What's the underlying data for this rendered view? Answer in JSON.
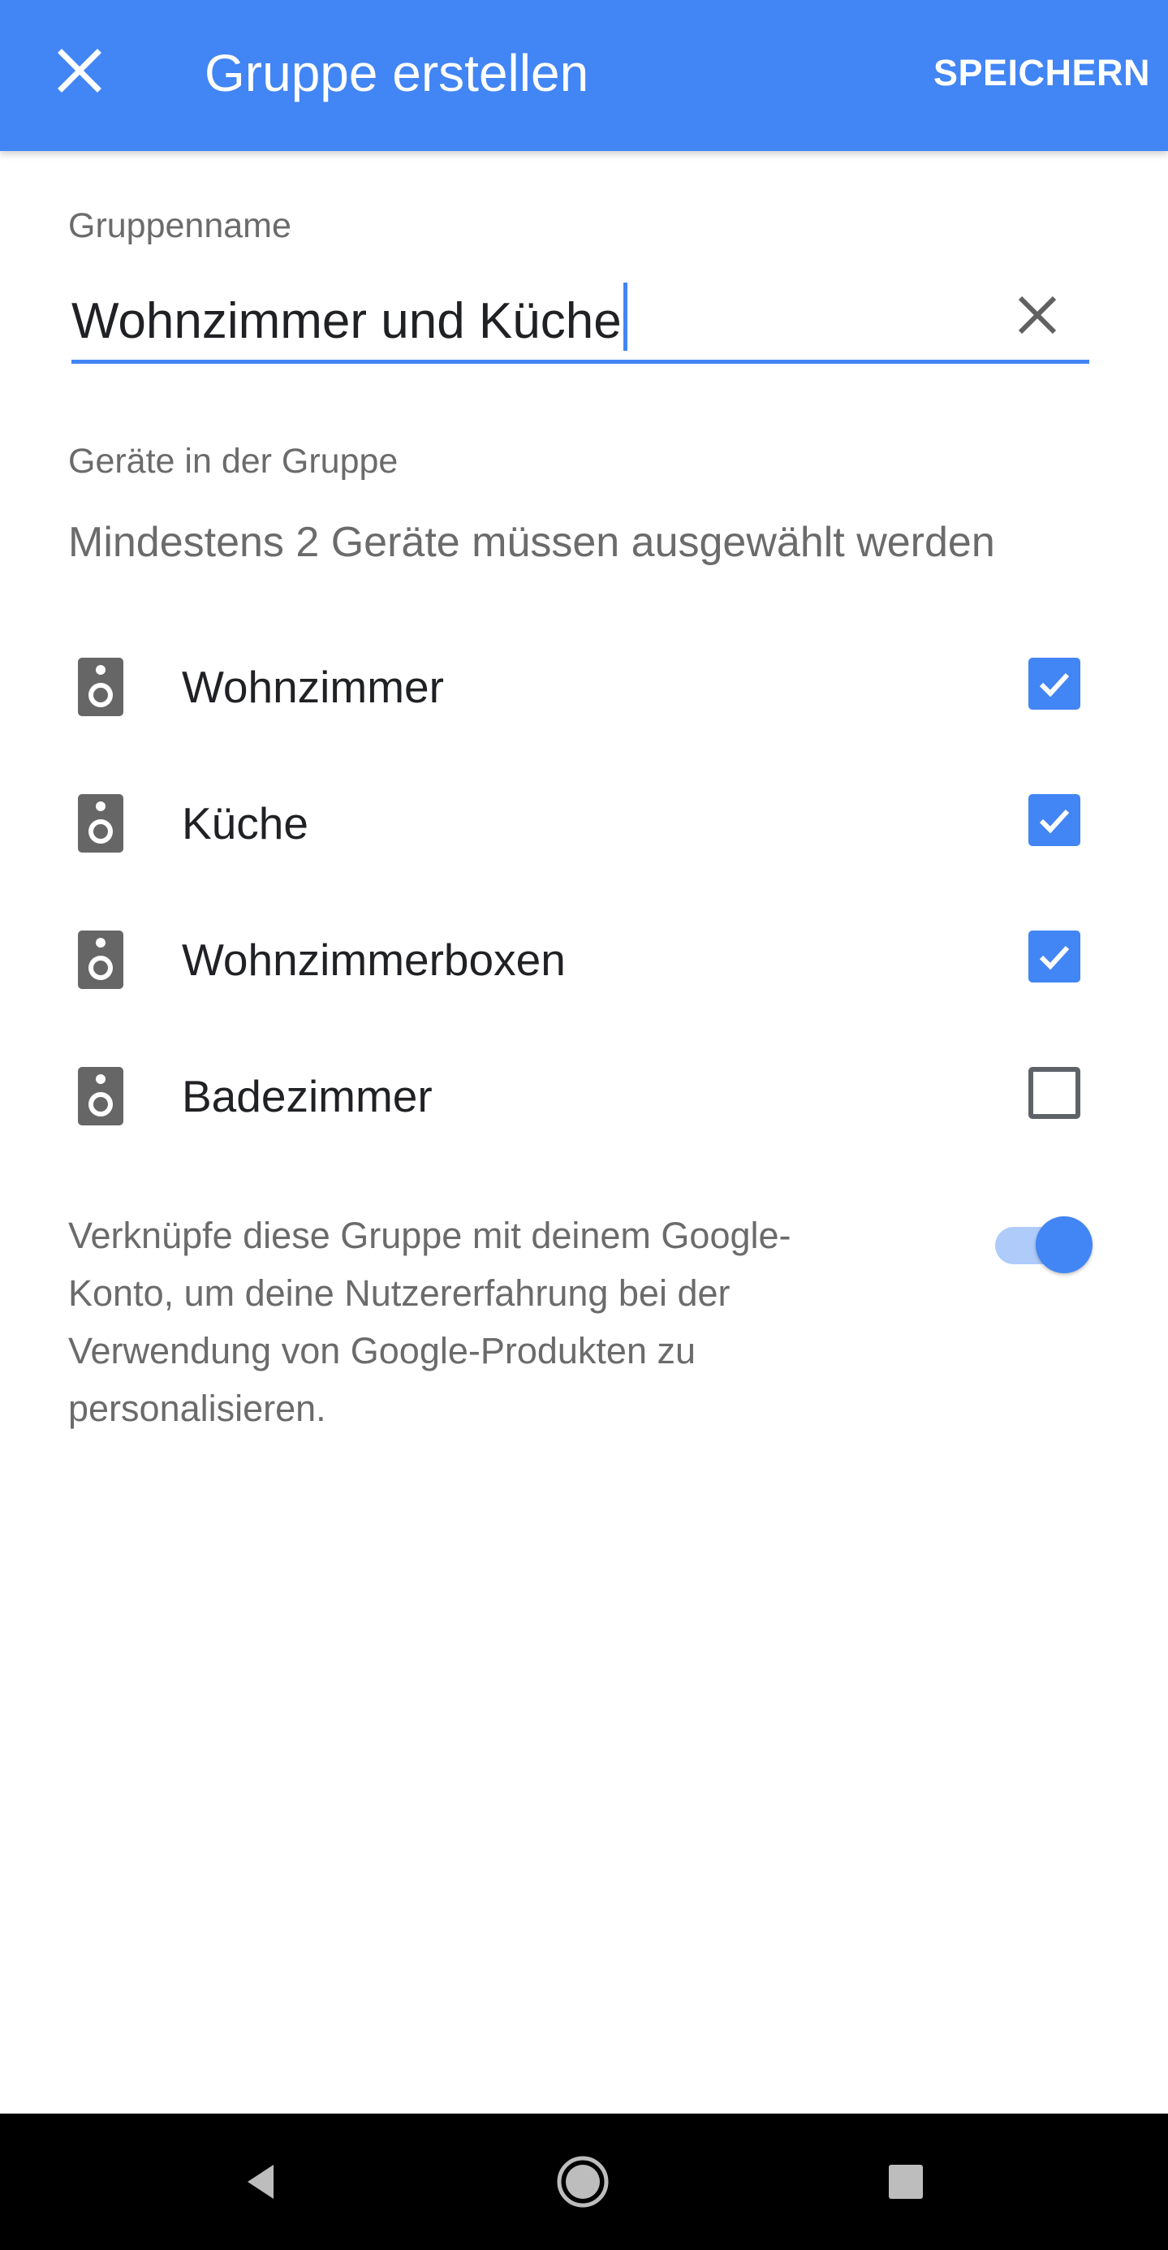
{
  "colors": {
    "accent": "#4285f4",
    "secondary_text": "#6b6b6b",
    "primary_text": "#202124",
    "nav_background": "#000000"
  },
  "app_bar": {
    "close_icon": "close-icon",
    "title": "Gruppe erstellen",
    "save_label": "SPEICHERN"
  },
  "group_name": {
    "label": "Gruppenname",
    "value": "Wohnzimmer und Küche",
    "clear_icon": "clear-icon"
  },
  "devices": {
    "section_label": "Geräte in der Gruppe",
    "hint": "Mindestens 2 Geräte müssen ausgewählt werden",
    "icon": "speaker-icon",
    "items": [
      {
        "label": "Wohnzimmer",
        "checked": true
      },
      {
        "label": "Küche",
        "checked": true
      },
      {
        "label": "Wohnzimmerboxen",
        "checked": true
      },
      {
        "label": "Badezimmer",
        "checked": false
      }
    ]
  },
  "link_account": {
    "text": "Verknüpfe diese Gruppe mit deinem Google-Konto, um deine Nutzererfahrung bei der Verwendung von Google-Produkten zu personalisieren.",
    "enabled": true
  },
  "system_nav": {
    "back_icon": "back-triangle-icon",
    "home_icon": "home-circle-icon",
    "recents_icon": "recents-square-icon"
  }
}
